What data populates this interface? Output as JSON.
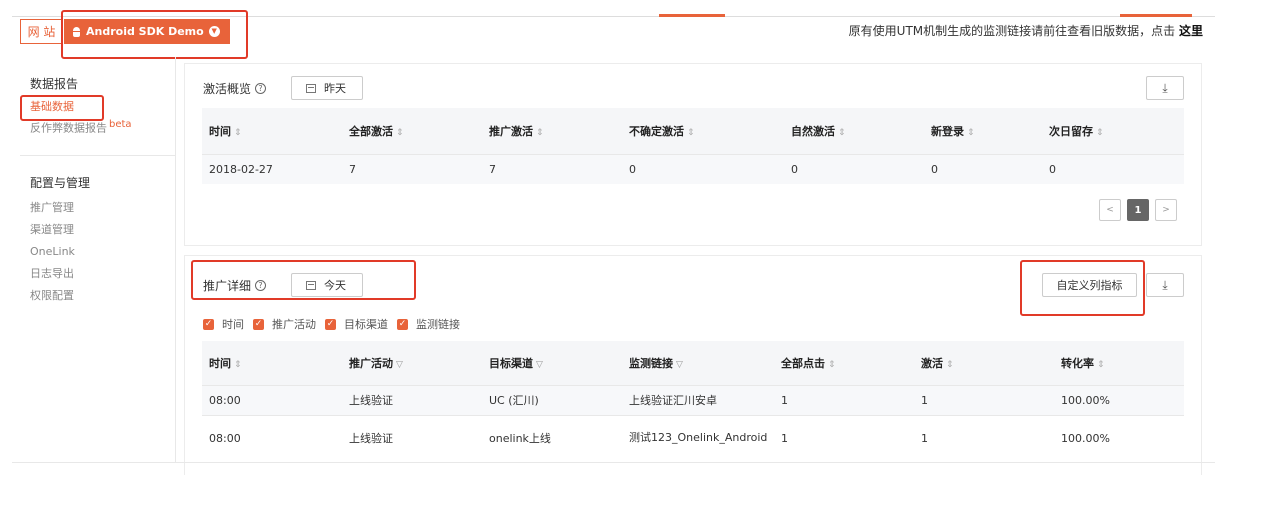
{
  "top": {
    "tab_web": "网 站",
    "tab_app": "Android SDK Demo",
    "notice_text": "原有使用UTM机制生成的监测链接请前往查看旧版数据，点击",
    "notice_link": "这里"
  },
  "sidebar": {
    "groups": [
      {
        "title": "数据报告",
        "items": [
          {
            "label": "基础数据"
          },
          {
            "label": "反作弊数据报告",
            "badge": "beta"
          }
        ]
      },
      {
        "title": "配置与管理",
        "items": [
          {
            "label": "推广管理"
          },
          {
            "label": "渠道管理"
          },
          {
            "label": "OneLink"
          },
          {
            "label": "日志导出"
          },
          {
            "label": "权限配置"
          }
        ]
      }
    ]
  },
  "overview": {
    "title": "激活概览",
    "date_label": "昨天",
    "columns": [
      "时间",
      "全部激活",
      "推广激活",
      "不确定激活",
      "自然激活",
      "新登录",
      "次日留存"
    ],
    "rows": [
      [
        "2018-02-27",
        "7",
        "7",
        "0",
        "0",
        "0",
        "0"
      ]
    ],
    "current_page": "1"
  },
  "detail": {
    "title": "推广详细",
    "date_label": "今天",
    "custom_button": "自定义列指标",
    "checkboxes": [
      "时间",
      "推广活动",
      "目标渠道",
      "监测链接"
    ],
    "columns": [
      "时间",
      "推广活动",
      "目标渠道",
      "监测链接",
      "全部点击",
      "激活",
      "转化率"
    ],
    "rows": [
      [
        "08:00",
        "上线验证",
        "UC (汇川)",
        "上线验证汇川安卓",
        "1",
        "1",
        "100.00%"
      ],
      [
        "08:00",
        "上线验证",
        "onelink上线",
        "测试123_Onelink_Android",
        "1",
        "1",
        "100.00%"
      ]
    ]
  },
  "colors": {
    "accent": "#e8633a",
    "highlight_box": "#e13a28"
  }
}
